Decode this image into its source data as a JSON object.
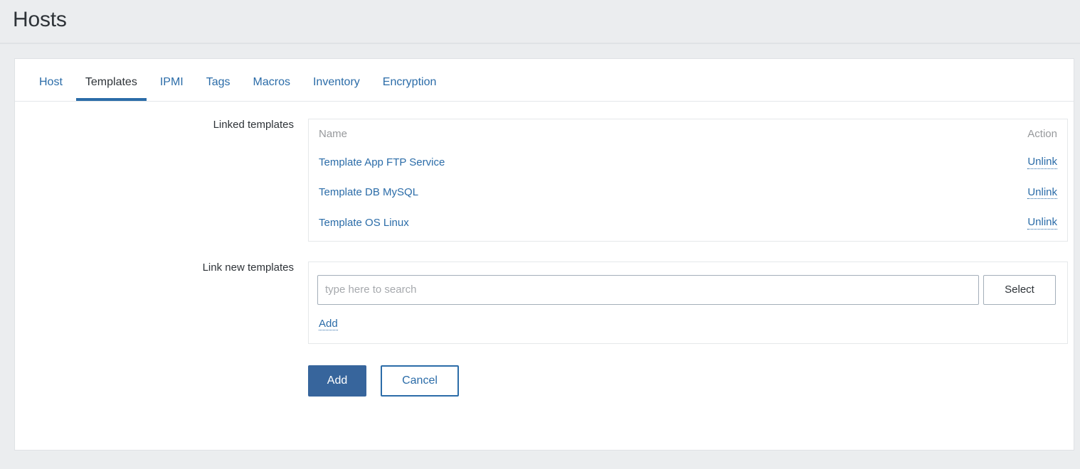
{
  "header": {
    "title": "Hosts"
  },
  "tabs": [
    {
      "label": "Host",
      "active": false
    },
    {
      "label": "Templates",
      "active": true
    },
    {
      "label": "IPMI",
      "active": false
    },
    {
      "label": "Tags",
      "active": false
    },
    {
      "label": "Macros",
      "active": false
    },
    {
      "label": "Inventory",
      "active": false
    },
    {
      "label": "Encryption",
      "active": false
    }
  ],
  "form": {
    "linked_templates": {
      "label": "Linked templates",
      "columns": {
        "name": "Name",
        "action": "Action"
      },
      "rows": [
        {
          "name": "Template App FTP Service",
          "action": "Unlink"
        },
        {
          "name": "Template DB MySQL",
          "action": "Unlink"
        },
        {
          "name": "Template OS Linux",
          "action": "Unlink"
        }
      ]
    },
    "link_new_templates": {
      "label": "Link new templates",
      "search_value": "",
      "search_placeholder": "type here to search",
      "select_label": "Select",
      "add_label": "Add"
    }
  },
  "footer": {
    "submit_label": "Add",
    "cancel_label": "Cancel"
  },
  "colors": {
    "accent": "#2b6ca8",
    "primary_button": "#37659c",
    "page_background": "#ebedef",
    "panel_background": "#ffffff",
    "muted_text": "#97999c",
    "body_text": "#2e3338"
  }
}
